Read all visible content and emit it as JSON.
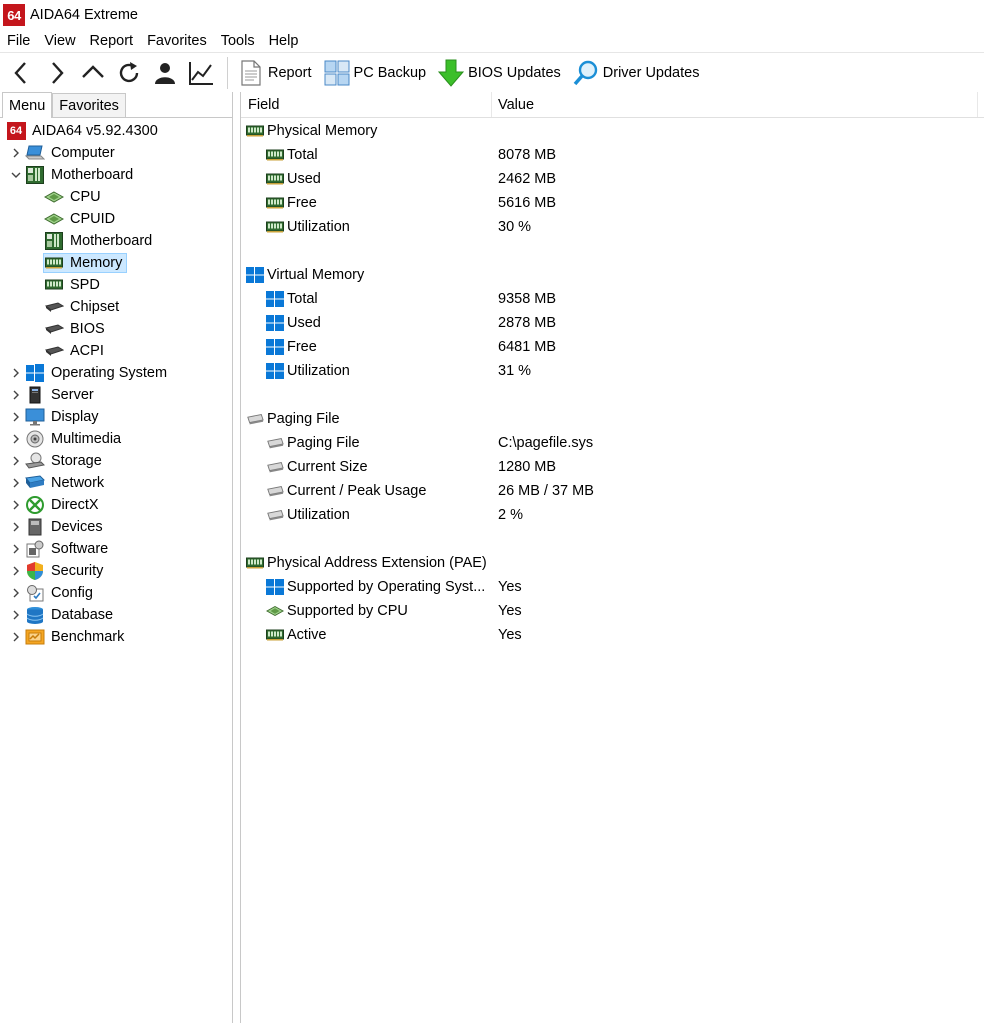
{
  "window": {
    "logo_text": "64",
    "title": "AIDA64 Extreme"
  },
  "menubar": [
    "File",
    "View",
    "Report",
    "Favorites",
    "Tools",
    "Help"
  ],
  "toolbar": {
    "buttons": [
      {
        "label": "Report",
        "icon": "report-icon"
      },
      {
        "label": "PC Backup",
        "icon": "pc-backup-icon"
      },
      {
        "label": "BIOS Updates",
        "icon": "bios-updates-icon"
      },
      {
        "label": "Driver Updates",
        "icon": "driver-updates-icon"
      }
    ]
  },
  "left_tabs": [
    "Menu",
    "Favorites"
  ],
  "tree": {
    "root": "AIDA64 v5.92.4300",
    "items": [
      {
        "label": "Computer",
        "level": 1,
        "expander": ">",
        "icon": "computer-icon"
      },
      {
        "label": "Motherboard",
        "level": 1,
        "expander": "v",
        "icon": "motherboard-icon"
      },
      {
        "label": "CPU",
        "level": 2,
        "icon": "cpu-icon"
      },
      {
        "label": "CPUID",
        "level": 2,
        "icon": "cpuid-icon"
      },
      {
        "label": "Motherboard",
        "level": 2,
        "icon": "motherboard-icon"
      },
      {
        "label": "Memory",
        "level": 2,
        "icon": "memory-icon",
        "selected": true
      },
      {
        "label": "SPD",
        "level": 2,
        "icon": "spd-icon"
      },
      {
        "label": "Chipset",
        "level": 2,
        "icon": "chipset-icon"
      },
      {
        "label": "BIOS",
        "level": 2,
        "icon": "bios-icon"
      },
      {
        "label": "ACPI",
        "level": 2,
        "icon": "acpi-icon"
      },
      {
        "label": "Operating System",
        "level": 1,
        "expander": ">",
        "icon": "windows-icon"
      },
      {
        "label": "Server",
        "level": 1,
        "expander": ">",
        "icon": "server-icon"
      },
      {
        "label": "Display",
        "level": 1,
        "expander": ">",
        "icon": "display-icon"
      },
      {
        "label": "Multimedia",
        "level": 1,
        "expander": ">",
        "icon": "multimedia-icon"
      },
      {
        "label": "Storage",
        "level": 1,
        "expander": ">",
        "icon": "storage-icon"
      },
      {
        "label": "Network",
        "level": 1,
        "expander": ">",
        "icon": "network-icon"
      },
      {
        "label": "DirectX",
        "level": 1,
        "expander": ">",
        "icon": "directx-icon"
      },
      {
        "label": "Devices",
        "level": 1,
        "expander": ">",
        "icon": "devices-icon"
      },
      {
        "label": "Software",
        "level": 1,
        "expander": ">",
        "icon": "software-icon"
      },
      {
        "label": "Security",
        "level": 1,
        "expander": ">",
        "icon": "security-icon"
      },
      {
        "label": "Config",
        "level": 1,
        "expander": ">",
        "icon": "config-icon"
      },
      {
        "label": "Database",
        "level": 1,
        "expander": ">",
        "icon": "database-icon"
      },
      {
        "label": "Benchmark",
        "level": 1,
        "expander": ">",
        "icon": "benchmark-icon"
      }
    ]
  },
  "columns": {
    "field": "Field",
    "value": "Value"
  },
  "groups": [
    {
      "title": "Physical Memory",
      "icon": "memory-icon",
      "rows": [
        {
          "field": "Total",
          "value": "8078 MB",
          "icon": "memory-icon"
        },
        {
          "field": "Used",
          "value": "2462 MB",
          "icon": "memory-icon"
        },
        {
          "field": "Free",
          "value": "5616 MB",
          "icon": "memory-icon"
        },
        {
          "field": "Utilization",
          "value": "30 %",
          "icon": "memory-icon"
        }
      ]
    },
    {
      "title": "Virtual Memory",
      "icon": "windows-icon",
      "rows": [
        {
          "field": "Total",
          "value": "9358 MB",
          "icon": "windows-icon"
        },
        {
          "field": "Used",
          "value": "2878 MB",
          "icon": "windows-icon"
        },
        {
          "field": "Free",
          "value": "6481 MB",
          "icon": "windows-icon"
        },
        {
          "field": "Utilization",
          "value": "31 %",
          "icon": "windows-icon"
        }
      ]
    },
    {
      "title": "Paging File",
      "icon": "drive-icon",
      "rows": [
        {
          "field": "Paging File",
          "value": "C:\\pagefile.sys",
          "icon": "drive-icon"
        },
        {
          "field": "Current Size",
          "value": "1280 MB",
          "icon": "drive-icon"
        },
        {
          "field": "Current / Peak Usage",
          "value": "26 MB / 37 MB",
          "icon": "drive-icon"
        },
        {
          "field": "Utilization",
          "value": "2 %",
          "icon": "drive-icon"
        }
      ]
    },
    {
      "title": "Physical Address Extension (PAE)",
      "icon": "memory-icon",
      "rows": [
        {
          "field": "Supported by Operating Syst...",
          "value": "Yes",
          "icon": "windows-icon"
        },
        {
          "field": "Supported by CPU",
          "value": "Yes",
          "icon": "cpu-icon"
        },
        {
          "field": "Active",
          "value": "Yes",
          "icon": "memory-icon"
        }
      ]
    }
  ]
}
